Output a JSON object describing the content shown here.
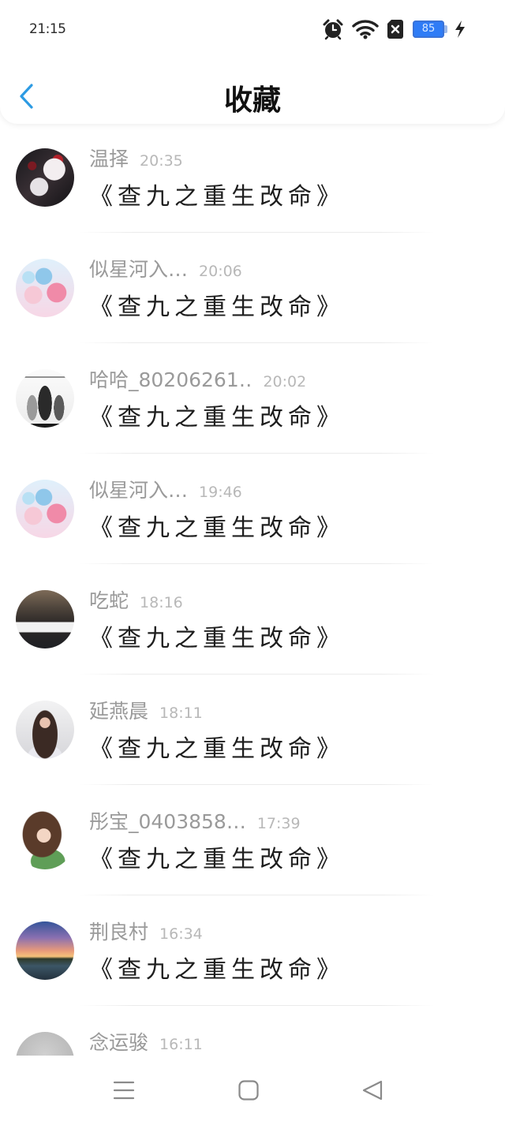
{
  "status_bar": {
    "time": "21:15",
    "battery_level": "85",
    "alarm_icon": "alarm-clock-icon",
    "wifi_icon": "wifi-icon",
    "sim_icon": "sim-card-off-icon",
    "battery_icon": "battery-icon",
    "charging_icon": "charging-bolt-icon",
    "battery_color": "#2f7cf6"
  },
  "header": {
    "title": "收藏",
    "back_icon": "chevron-left-icon",
    "back_color": "#2d9be3"
  },
  "favorites": [
    {
      "name": "温择",
      "time": "20:35",
      "content": "《查九之重生改命》"
    },
    {
      "name": "似星河入…",
      "time": "20:06",
      "content": "《查九之重生改命》"
    },
    {
      "name": "哈哈_80206261‥",
      "time": "20:02",
      "content": "《查九之重生改命》"
    },
    {
      "name": "似星河入…",
      "time": "19:46",
      "content": "《查九之重生改命》"
    },
    {
      "name": "吃蛇",
      "time": "18:16",
      "content": "《查九之重生改命》"
    },
    {
      "name": "延燕晨",
      "time": "18:11",
      "content": "《查九之重生改命》"
    },
    {
      "name": "彤宝_0403858…",
      "time": "17:39",
      "content": "《查九之重生改命》"
    },
    {
      "name": "荆良村",
      "time": "16:34",
      "content": "《查九之重生改命》"
    },
    {
      "name": "念运骏",
      "time": "16:11"
    }
  ],
  "nav_bar": {
    "menu_icon": "menu-icon",
    "home_icon": "square-home-icon",
    "back_icon": "triangle-back-icon",
    "icon_color": "#8a8a8a"
  }
}
